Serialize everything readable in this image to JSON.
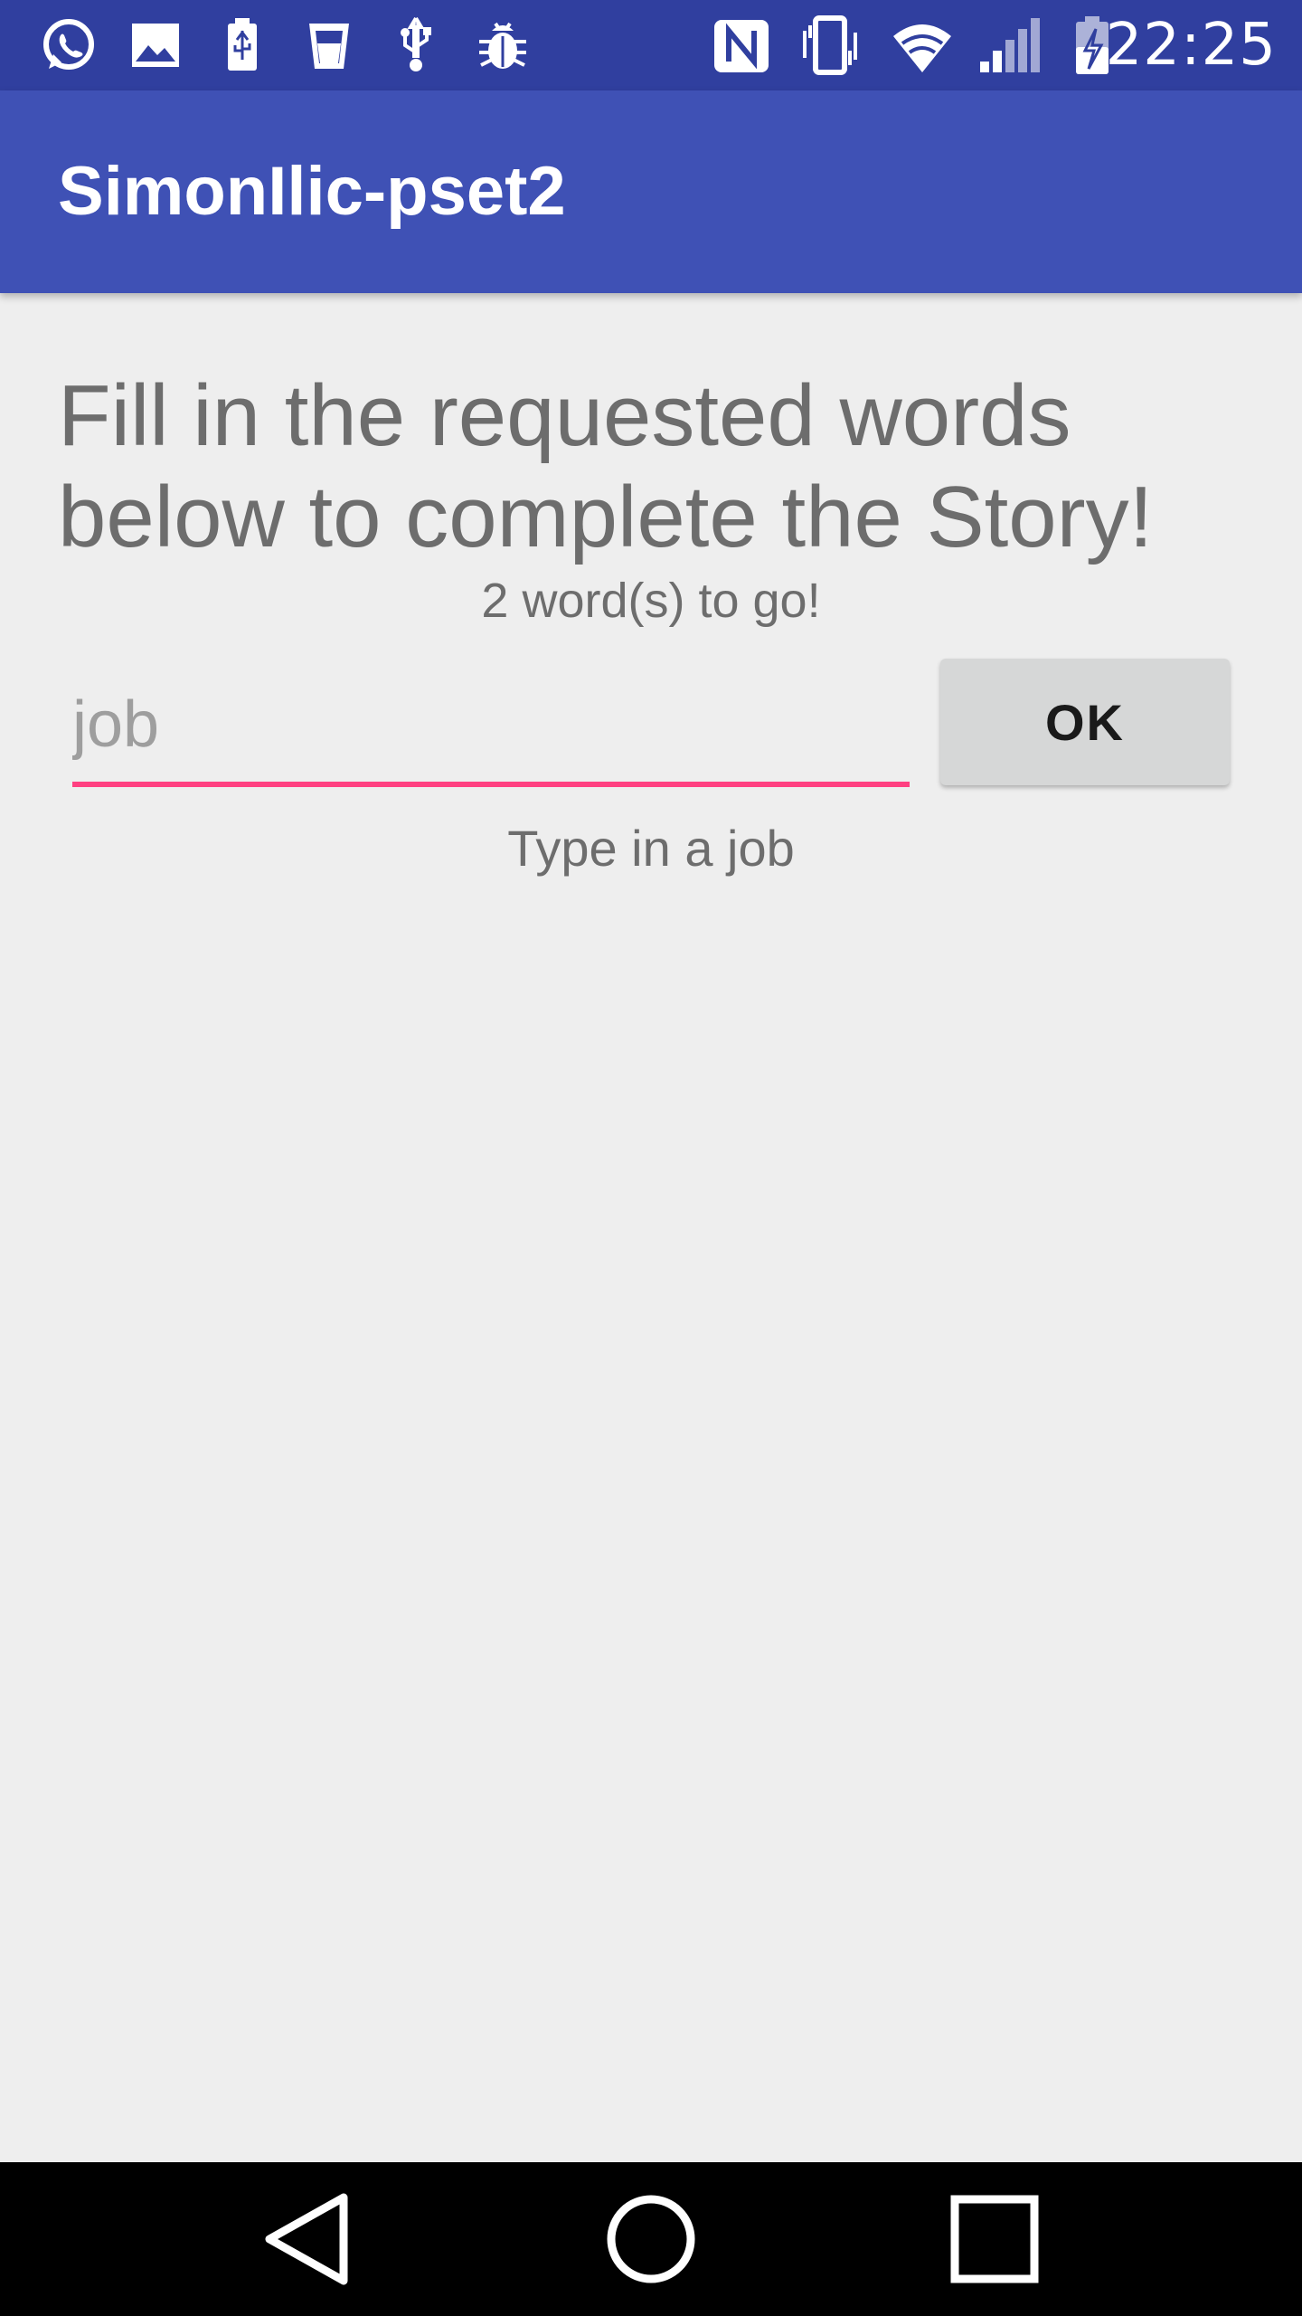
{
  "status_bar": {
    "time": "22:25",
    "left_icons": [
      "whatsapp-icon",
      "image-icon",
      "battery-usb-icon",
      "cup-icon",
      "usb-icon",
      "debug-bug-icon"
    ],
    "right_icons": [
      "nfc-icon",
      "vibrate-icon",
      "wifi-icon",
      "signal-icon",
      "battery-charging-icon"
    ]
  },
  "app_bar": {
    "title": "SimonIlic-pset2",
    "color": "#3f51b5"
  },
  "main": {
    "heading": "Fill in the requested words below to complete the Story!",
    "counter_text": "2 word(s) to go!",
    "input": {
      "value": "",
      "placeholder": "job",
      "accent": "#ff4081"
    },
    "ok_label": "OK",
    "hint": "Type in a job"
  },
  "nav_bar": {
    "buttons": [
      "back-icon",
      "home-icon",
      "recents-icon"
    ]
  }
}
